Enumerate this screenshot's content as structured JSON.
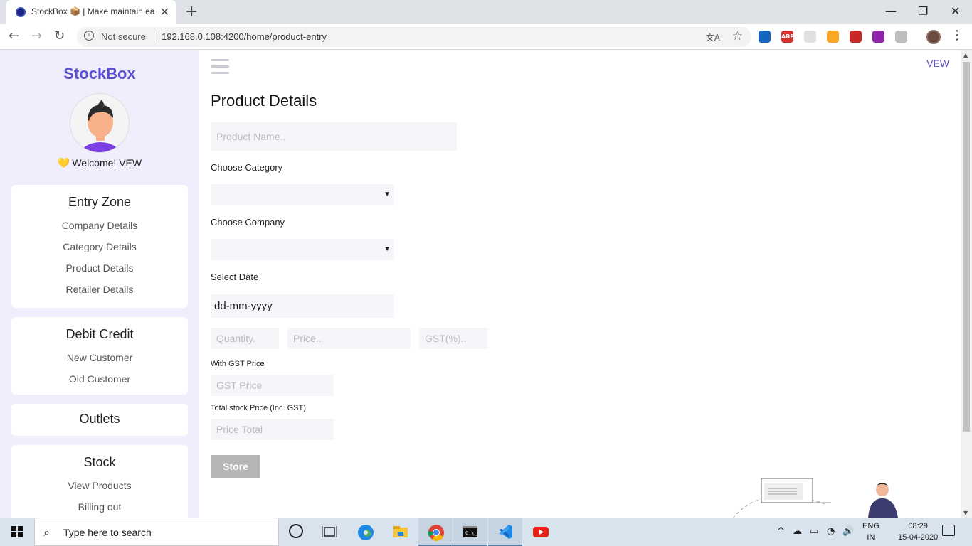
{
  "browser": {
    "tab_title": "StockBox 📦 | Make maintain ea",
    "tab_close": "✕",
    "new_tab": "+",
    "window": {
      "minimize": "—",
      "restore": "❐",
      "close": "✕"
    },
    "nav": {
      "back": "←",
      "forward": "→",
      "reload": "↻"
    },
    "security_label": "Not secure",
    "url": "192.168.0.108:4200/home/product-entry",
    "translate_icon": "translate-icon",
    "bookmark_icon": "☆",
    "extensions": [
      {
        "name": "screenshot-icon",
        "color": "#1565c0",
        "text": ""
      },
      {
        "name": "adblock-icon",
        "color": "#d32f2f",
        "text": "ABP"
      },
      {
        "name": "grid-icon",
        "color": "#e0e0e0",
        "text": ""
      },
      {
        "name": "moon-icon",
        "color": "#f9a825",
        "text": ""
      },
      {
        "name": "media-icon",
        "color": "#c62828",
        "text": ""
      },
      {
        "name": "purple-ext-icon",
        "color": "#8e24aa",
        "text": ""
      },
      {
        "name": "timer-icon",
        "color": "#bdbdbd",
        "text": ""
      }
    ],
    "menu": "⋮"
  },
  "sidebar": {
    "brand": "StockBox",
    "welcome": "Welcome! VEW",
    "welcome_icon": "💛",
    "sections": [
      {
        "head": "Entry Zone",
        "links": [
          "Company Details",
          "Category Details",
          "Product Details",
          "Retailer Details"
        ]
      },
      {
        "head": "Debit Credit",
        "links": [
          "New Customer",
          "Old Customer"
        ]
      },
      {
        "head": "Outlets",
        "links": []
      },
      {
        "head": "Stock",
        "links": [
          "View Products",
          "Billing out"
        ]
      }
    ]
  },
  "main": {
    "user": "VEW",
    "title": "Product Details",
    "product_name_placeholder": "Product Name..",
    "category_label": "Choose Category",
    "company_label": "Choose Company",
    "date_label": "Select Date",
    "date_value": "dd-mm-yyyy",
    "quantity_placeholder": "Quantity.",
    "price_placeholder": "Price..",
    "gst_placeholder": "GST(%)..",
    "with_gst_label": "With GST Price",
    "gst_price_placeholder": "GST Price",
    "total_label": "Total stock Price (Inc. GST)",
    "total_placeholder": "Price Total",
    "store_button": "Store",
    "caret": "▼"
  },
  "taskbar": {
    "search_placeholder": "Type here to search",
    "lang_top": "ENG",
    "lang_bottom": "IN",
    "time": "08:29",
    "date": "15-04-2020",
    "tray_up": "^",
    "volume": "🔊"
  }
}
